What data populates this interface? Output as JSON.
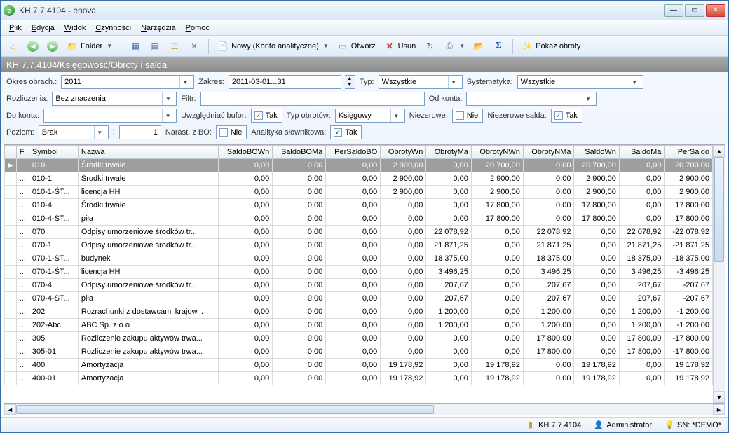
{
  "window": {
    "title": "KH 7.7.4104 - enova"
  },
  "menu": {
    "plik": "Plik",
    "edycja": "Edycja",
    "widok": "Widok",
    "czynnosci": "Czynności",
    "narzedzia": "Narzędzia",
    "pomoc": "Pomoc"
  },
  "toolbar": {
    "folder": "Folder",
    "nowy": "Nowy (Konto analityczne)",
    "otworz": "Otwórz",
    "usun": "Usuń",
    "pokaz_obroty": "Pokaż obroty"
  },
  "breadcrumb": "KH 7.7.4104/Księgowość/Obroty i salda",
  "filters": {
    "okres_obrach_label": "Okres obrach.:",
    "okres_obrach_value": "2011",
    "zakres_label": "Zakres:",
    "zakres_value": "2011-03-01...31",
    "typ_label": "Typ:",
    "typ_value": "Wszystkie",
    "systematyka_label": "Systematyka:",
    "systematyka_value": "Wszystkie",
    "rozliczenia_label": "Rozliczenia:",
    "rozliczenia_value": "Bez znaczenia",
    "filtr_label": "Filtr:",
    "filtr_value": "",
    "od_konta_label": "Od konta:",
    "od_konta_value": "",
    "do_konta_label": "Do konta:",
    "do_konta_value": "",
    "uwzgledniac_bufor_label": "Uwzględniać bufor:",
    "uwzgledniac_bufor_checked": true,
    "uwzgledniac_bufor_txt": "Tak",
    "typ_obrotow_label": "Typ obrotów:",
    "typ_obrotow_value": "Księgowy",
    "niezerowe_label": "Niezerowe:",
    "niezerowe_checked": false,
    "niezerowe_txt": "Nie",
    "niezerowe_salda_label": "Niezerowe salda:",
    "niezerowe_salda_checked": true,
    "niezerowe_salda_txt": "Tak",
    "poziom_label": "Poziom:",
    "poziom_value": "Brak",
    "poziom_num": "1",
    "narast_label": "Narast. z BO:",
    "narast_checked": false,
    "narast_txt": "Nie",
    "analityka_label": "Analityka słownikowa:",
    "analityka_checked": true,
    "analityka_txt": "Tak"
  },
  "grid": {
    "headers": {
      "f": "F",
      "symbol": "Symbol",
      "nazwa": "Nazwa",
      "saldoBOWn": "SaldoBOWn",
      "saldoBOMa": "SaldoBOMa",
      "perSaldoBO": "PerSaldoBO",
      "obrotyWn": "ObrotyWn",
      "obrotyMa": "ObrotyMa",
      "obrotyNWn": "ObrotyNWn",
      "obrotyNMa": "ObrotyNMa",
      "saldoWn": "SaldoWn",
      "saldoMa": "SaldoMa",
      "perSaldo": "PerSaldo"
    },
    "rows": [
      {
        "sel": true,
        "symbol": "010",
        "nazwa": "Środki trwałe",
        "a": "0,00",
        "b": "0,00",
        "c": "0,00",
        "d": "2 900,00",
        "e": "0,00",
        "f": "20 700,00",
        "g": "0,00",
        "h": "20 700,00",
        "i": "0,00",
        "j": "20 700,00"
      },
      {
        "symbol": "010-1",
        "nazwa": "Środki trwałe",
        "a": "0,00",
        "b": "0,00",
        "c": "0,00",
        "d": "2 900,00",
        "e": "0,00",
        "f": "2 900,00",
        "g": "0,00",
        "h": "2 900,00",
        "i": "0,00",
        "j": "2 900,00"
      },
      {
        "symbol": "010-1-ŚT...",
        "nazwa": "licencja HH",
        "a": "0,00",
        "b": "0,00",
        "c": "0,00",
        "d": "2 900,00",
        "e": "0,00",
        "f": "2 900,00",
        "g": "0,00",
        "h": "2 900,00",
        "i": "0,00",
        "j": "2 900,00"
      },
      {
        "symbol": "010-4",
        "nazwa": "Środki trwałe",
        "a": "0,00",
        "b": "0,00",
        "c": "0,00",
        "d": "0,00",
        "e": "0,00",
        "f": "17 800,00",
        "g": "0,00",
        "h": "17 800,00",
        "i": "0,00",
        "j": "17 800,00"
      },
      {
        "symbol": "010-4-ŚT...",
        "nazwa": "piła",
        "a": "0,00",
        "b": "0,00",
        "c": "0,00",
        "d": "0,00",
        "e": "0,00",
        "f": "17 800,00",
        "g": "0,00",
        "h": "17 800,00",
        "i": "0,00",
        "j": "17 800,00"
      },
      {
        "symbol": "070",
        "nazwa": "Odpisy umorzeniowe środków tr...",
        "a": "0,00",
        "b": "0,00",
        "c": "0,00",
        "d": "0,00",
        "e": "22 078,92",
        "f": "0,00",
        "g": "22 078,92",
        "h": "0,00",
        "i": "22 078,92",
        "j": "-22 078,92"
      },
      {
        "symbol": "070-1",
        "nazwa": "Odpisy umorzeniowe środków tr...",
        "a": "0,00",
        "b": "0,00",
        "c": "0,00",
        "d": "0,00",
        "e": "21 871,25",
        "f": "0,00",
        "g": "21 871,25",
        "h": "0,00",
        "i": "21 871,25",
        "j": "-21 871,25"
      },
      {
        "symbol": "070-1-ŚT...",
        "nazwa": "budynek",
        "a": "0,00",
        "b": "0,00",
        "c": "0,00",
        "d": "0,00",
        "e": "18 375,00",
        "f": "0,00",
        "g": "18 375,00",
        "h": "0,00",
        "i": "18 375,00",
        "j": "-18 375,00"
      },
      {
        "symbol": "070-1-ŚT...",
        "nazwa": "licencja HH",
        "a": "0,00",
        "b": "0,00",
        "c": "0,00",
        "d": "0,00",
        "e": "3 496,25",
        "f": "0,00",
        "g": "3 496,25",
        "h": "0,00",
        "i": "3 496,25",
        "j": "-3 496,25"
      },
      {
        "symbol": "070-4",
        "nazwa": "Odpisy umorzeniowe środków tr...",
        "a": "0,00",
        "b": "0,00",
        "c": "0,00",
        "d": "0,00",
        "e": "207,67",
        "f": "0,00",
        "g": "207,67",
        "h": "0,00",
        "i": "207,67",
        "j": "-207,67"
      },
      {
        "symbol": "070-4-ŚT...",
        "nazwa": "piła",
        "a": "0,00",
        "b": "0,00",
        "c": "0,00",
        "d": "0,00",
        "e": "207,67",
        "f": "0,00",
        "g": "207,67",
        "h": "0,00",
        "i": "207,67",
        "j": "-207,67"
      },
      {
        "symbol": "202",
        "nazwa": "Rozrachunki z dostawcami krajow...",
        "a": "0,00",
        "b": "0,00",
        "c": "0,00",
        "d": "0,00",
        "e": "1 200,00",
        "f": "0,00",
        "g": "1 200,00",
        "h": "0,00",
        "i": "1 200,00",
        "j": "-1 200,00"
      },
      {
        "symbol": "202-Abc",
        "nazwa": "ABC Sp. z o.o",
        "a": "0,00",
        "b": "0,00",
        "c": "0,00",
        "d": "0,00",
        "e": "1 200,00",
        "f": "0,00",
        "g": "1 200,00",
        "h": "0,00",
        "i": "1 200,00",
        "j": "-1 200,00"
      },
      {
        "symbol": "305",
        "nazwa": "Rozliczenie zakupu aktywów trwa...",
        "a": "0,00",
        "b": "0,00",
        "c": "0,00",
        "d": "0,00",
        "e": "0,00",
        "f": "0,00",
        "g": "17 800,00",
        "h": "0,00",
        "i": "17 800,00",
        "j": "-17 800,00"
      },
      {
        "symbol": "305-01",
        "nazwa": "Rozliczenie zakupu aktywów trwa...",
        "a": "0,00",
        "b": "0,00",
        "c": "0,00",
        "d": "0,00",
        "e": "0,00",
        "f": "0,00",
        "g": "17 800,00",
        "h": "0,00",
        "i": "17 800,00",
        "j": "-17 800,00"
      },
      {
        "symbol": "400",
        "nazwa": "Amortyzacja",
        "a": "0,00",
        "b": "0,00",
        "c": "0,00",
        "d": "19 178,92",
        "e": "0,00",
        "f": "19 178,92",
        "g": "0,00",
        "h": "19 178,92",
        "i": "0,00",
        "j": "19 178,92"
      },
      {
        "symbol": "400-01",
        "nazwa": "Amortyzacja",
        "a": "0,00",
        "b": "0,00",
        "c": "0,00",
        "d": "19 178,92",
        "e": "0,00",
        "f": "19 178,92",
        "g": "0,00",
        "h": "19 178,92",
        "i": "0,00",
        "j": "19 178,92"
      }
    ]
  },
  "status": {
    "version": "KH 7.7.4104",
    "user": "Administrator",
    "license": "SN: *DEMO*"
  }
}
